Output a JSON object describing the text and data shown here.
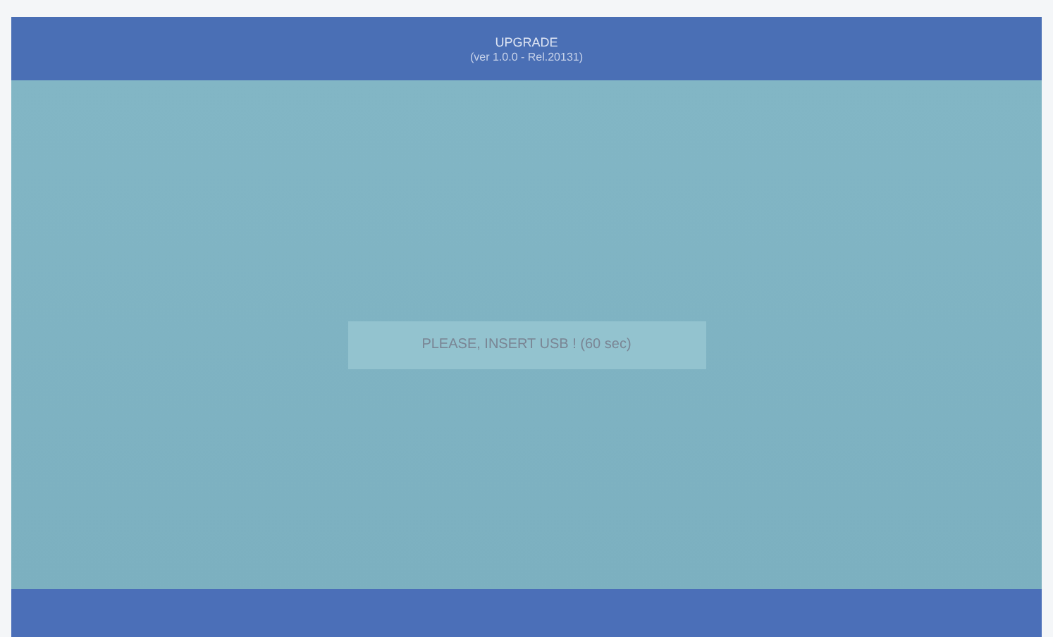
{
  "header": {
    "title": "UPGRADE",
    "subtitle": "(ver 1.0.0 - Rel.20131)"
  },
  "message": "PLEASE, INSERT USB ! (60 sec)"
}
